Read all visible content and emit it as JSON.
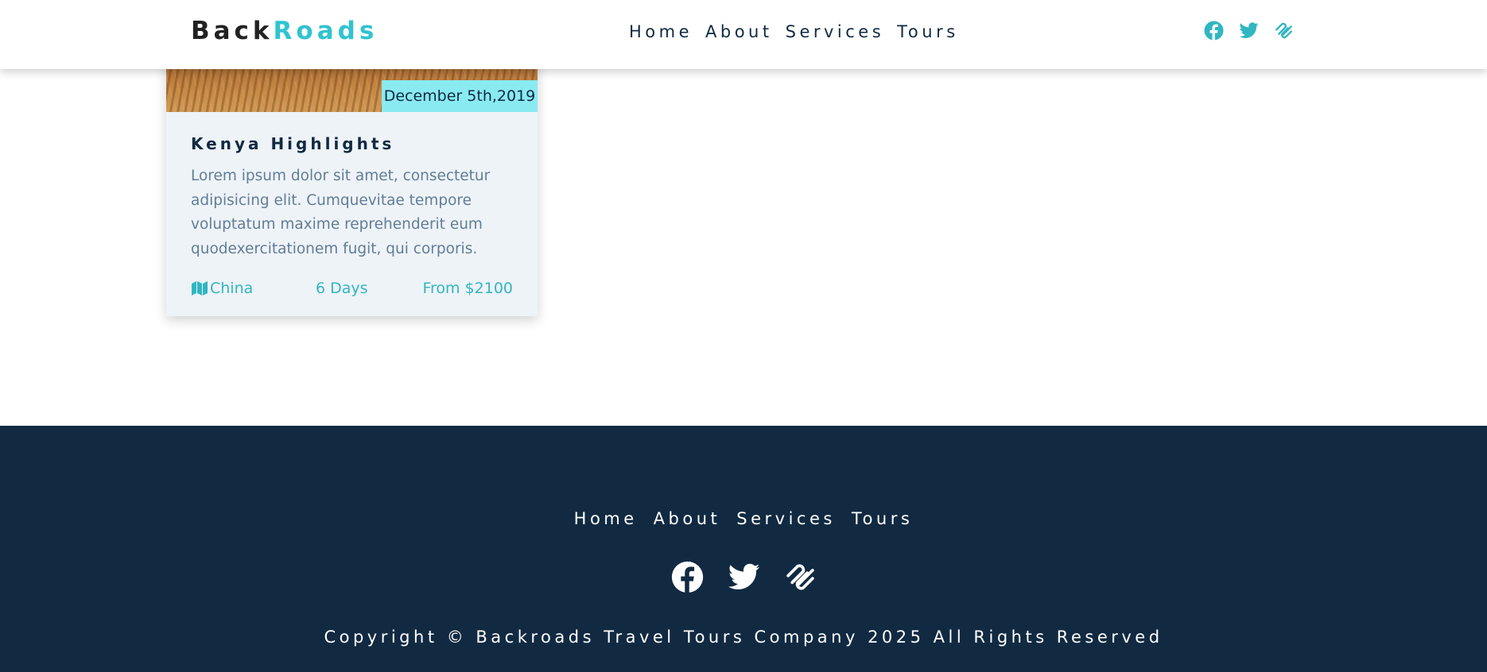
{
  "nav": {
    "logo_part1": "Back",
    "logo_part2": "Roads",
    "links": [
      "Home",
      "About",
      "Services",
      "Tours"
    ],
    "icons": [
      "facebook-icon",
      "twitter-icon",
      "squarespace-icon"
    ]
  },
  "card": {
    "date": "December 5th,2019",
    "title": "Kenya Highlights",
    "text": "Lorem ipsum dolor sit amet, consectetur adipisicing elit. Cumquevitae tempore voluptatum maxime reprehenderit eum quodexercitationem fugit, qui corporis.",
    "location": "China",
    "location_icon": "map-icon",
    "duration": "6 Days",
    "price": "From $2100"
  },
  "footer": {
    "links": [
      "Home",
      "About",
      "Services",
      "Tours"
    ],
    "icons": [
      "facebook-icon",
      "twitter-icon",
      "squarespace-icon"
    ],
    "copyright": "Copyright © Backroads Travel Tours Company 2025 All Rights Reserved"
  },
  "colors": {
    "brand_accent": "#31c3d0",
    "dark_navy": "#102a42",
    "footer_bg": "#112a42",
    "card_bg": "#eef3f7",
    "date_badge": "#8aeaf2",
    "muted_text": "#617d98"
  }
}
